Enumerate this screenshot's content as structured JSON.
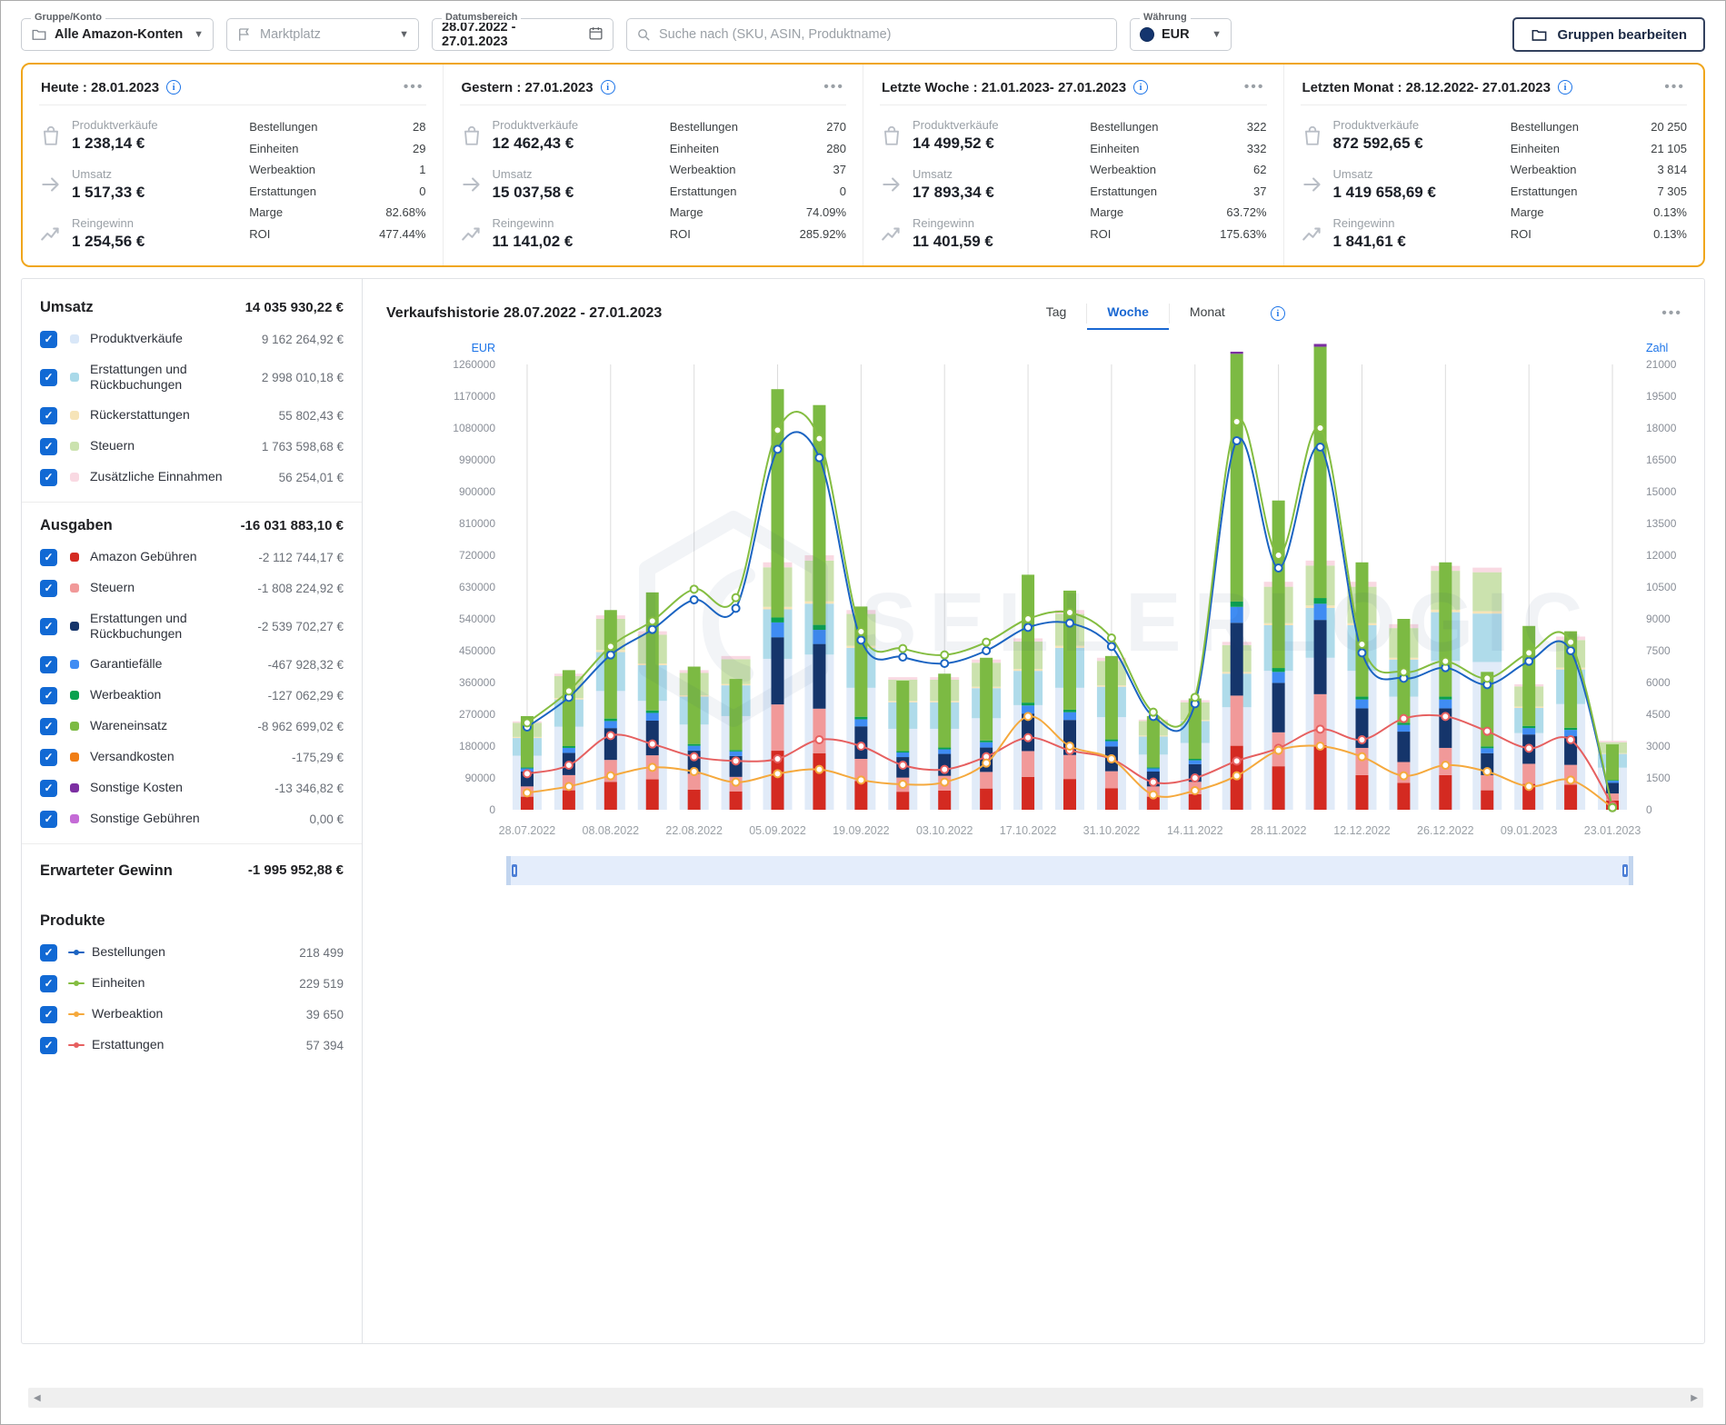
{
  "topbar": {
    "group_label": "Gruppe/Konto",
    "group_value": "Alle Amazon-Konten",
    "marketplace_placeholder": "Marktplatz",
    "daterange_label": "Datumsbereich",
    "daterange_value": "28.07.2022 - 27.01.2023",
    "search_placeholder": "Suche nach (SKU, ASIN, Produktname)",
    "currency_label": "Währung",
    "currency_value": "EUR",
    "edit_groups_label": "Gruppen bearbeiten"
  },
  "cards": [
    {
      "title": "Heute : 28.01.2023",
      "stats": [
        {
          "label": "Produktverkäufe",
          "value": "1 238,14 €",
          "icon": "bag"
        },
        {
          "label": "Umsatz",
          "value": "1 517,33 €",
          "icon": "arrow"
        },
        {
          "label": "Reingewinn",
          "value": "1 254,56 €",
          "icon": "trend"
        }
      ],
      "metrics": [
        [
          "Bestellungen",
          "28"
        ],
        [
          "Einheiten",
          "29"
        ],
        [
          "Werbeaktion",
          "1"
        ],
        [
          "Erstattungen",
          "0"
        ],
        [
          "Marge",
          "82.68%"
        ],
        [
          "ROI",
          "477.44%"
        ]
      ]
    },
    {
      "title": "Gestern : 27.01.2023",
      "stats": [
        {
          "label": "Produktverkäufe",
          "value": "12 462,43 €",
          "icon": "bag"
        },
        {
          "label": "Umsatz",
          "value": "15 037,58 €",
          "icon": "arrow"
        },
        {
          "label": "Reingewinn",
          "value": "11 141,02 €",
          "icon": "trend"
        }
      ],
      "metrics": [
        [
          "Bestellungen",
          "270"
        ],
        [
          "Einheiten",
          "280"
        ],
        [
          "Werbeaktion",
          "37"
        ],
        [
          "Erstattungen",
          "0"
        ],
        [
          "Marge",
          "74.09%"
        ],
        [
          "ROI",
          "285.92%"
        ]
      ]
    },
    {
      "title": "Letzte Woche : 21.01.2023- 27.01.2023",
      "stats": [
        {
          "label": "Produktverkäufe",
          "value": "14 499,52 €",
          "icon": "bag"
        },
        {
          "label": "Umsatz",
          "value": "17 893,34 €",
          "icon": "arrow"
        },
        {
          "label": "Reingewinn",
          "value": "11 401,59 €",
          "icon": "trend"
        }
      ],
      "metrics": [
        [
          "Bestellungen",
          "322"
        ],
        [
          "Einheiten",
          "332"
        ],
        [
          "Werbeaktion",
          "62"
        ],
        [
          "Erstattungen",
          "37"
        ],
        [
          "Marge",
          "63.72%"
        ],
        [
          "ROI",
          "175.63%"
        ]
      ]
    },
    {
      "title": "Letzten Monat : 28.12.2022- 27.01.2023",
      "stats": [
        {
          "label": "Produktverkäufe",
          "value": "872 592,65 €",
          "icon": "bag"
        },
        {
          "label": "Umsatz",
          "value": "1 419 658,69 €",
          "icon": "arrow"
        },
        {
          "label": "Reingewinn",
          "value": "1 841,61 €",
          "icon": "trend"
        }
      ],
      "metrics": [
        [
          "Bestellungen",
          "20 250"
        ],
        [
          "Einheiten",
          "21 105"
        ],
        [
          "Werbeaktion",
          "3 814"
        ],
        [
          "Erstattungen",
          "7 305"
        ],
        [
          "Marge",
          "0.13%"
        ],
        [
          "ROI",
          "0.13%"
        ]
      ]
    }
  ],
  "sidebar": {
    "umsatz": {
      "title": "Umsatz",
      "total": "14 035 930,22 €",
      "items": [
        {
          "label": "Produktverkäufe",
          "value": "9 162 264,92 €",
          "color": "#D9E7F8"
        },
        {
          "label": "Erstattungen und Rückbuchungen",
          "value": "2 998 010,18 €",
          "color": "#A9D9E9"
        },
        {
          "label": "Rückerstattungen",
          "value": "55 802,43 €",
          "color": "#F6E4B8"
        },
        {
          "label": "Steuern",
          "value": "1 763 598,68 €",
          "color": "#CBE2AE"
        },
        {
          "label": "Zusätzliche Einnahmen",
          "value": "56 254,01 €",
          "color": "#F9D9E2"
        }
      ]
    },
    "ausgaben": {
      "title": "Ausgaben",
      "total": "-16 031 883,10 €",
      "items": [
        {
          "label": "Amazon Gebühren",
          "value": "-2 112 744,17 €",
          "color": "#D42A21"
        },
        {
          "label": "Steuern",
          "value": "-1 808 224,92 €",
          "color": "#F19999"
        },
        {
          "label": "Erstattungen und Rückbuchungen",
          "value": "-2 539 702,27 €",
          "color": "#15356B"
        },
        {
          "label": "Garantiefälle",
          "value": "-467 928,32 €",
          "color": "#3F8CF3"
        },
        {
          "label": "Werbeaktion",
          "value": "-127 062,29 €",
          "color": "#0AA14F"
        },
        {
          "label": "Wareneinsatz",
          "value": "-8 962 699,02 €",
          "color": "#7CBA43"
        },
        {
          "label": "Versandkosten",
          "value": "-175,29 €",
          "color": "#F07D14"
        },
        {
          "label": "Sonstige Kosten",
          "value": "-13 346,82 €",
          "color": "#7C2FA2"
        },
        {
          "label": "Sonstige Gebühren",
          "value": "0,00 €",
          "color": "#C46BD6"
        }
      ]
    },
    "gewinn": {
      "title": "Erwarteter Gewinn",
      "total": "-1 995 952,88 €"
    },
    "produkte": {
      "title": "Produkte",
      "items": [
        {
          "label": "Bestellungen",
          "value": "218 499",
          "color": "#1B64C2"
        },
        {
          "label": "Einheiten",
          "value": "229 519",
          "color": "#84BD41"
        },
        {
          "label": "Werbeaktion",
          "value": "39 650",
          "color": "#F5A93D"
        },
        {
          "label": "Erstattungen",
          "value": "57 394",
          "color": "#E66060"
        }
      ]
    }
  },
  "chart": {
    "title": "Verkaufshistorie 28.07.2022 - 27.01.2023",
    "tabs": [
      "Tag",
      "Woche",
      "Monat"
    ],
    "active_tab": "Woche",
    "watermark": "SELLERLOGIC"
  },
  "chart_data": {
    "type": "bar",
    "subtype": "stacked-bars-with-lines",
    "title": "Verkaufshistorie 28.07.2022 - 27.01.2023",
    "axis_left": {
      "label": "EUR",
      "min": 0,
      "max": 1260000,
      "step": 90000
    },
    "axis_right": {
      "label": "Zahl",
      "min": 0,
      "max": 21000,
      "step": 1500
    },
    "x_tick_labels": [
      "28.07.2022",
      "08.08.2022",
      "22.08.2022",
      "05.09.2022",
      "19.09.2022",
      "03.10.2022",
      "17.10.2022",
      "31.10.2022",
      "14.11.2022",
      "28.11.2022",
      "12.12.2022",
      "26.12.2022",
      "09.01.2023",
      "23.01.2023"
    ],
    "bar_count": 27,
    "revenue_stack": [
      {
        "name": "Produktverkäufe",
        "color": "#E1EBF8",
        "values": [
          153000,
          235000,
          336000,
          308000,
          241000,
          265000,
          427000,
          439000,
          345000,
          229000,
          229000,
          259000,
          296000,
          345000,
          262000,
          156000,
          189000,
          290000,
          393000,
          430000,
          393000,
          320000,
          421000,
          418000,
          217000,
          299000,
          119000
        ]
      },
      {
        "name": "Erstattungen und Rückbuchungen",
        "color": "#AFDBEA",
        "values": [
          50000,
          77000,
          110000,
          101000,
          79000,
          87000,
          140000,
          144000,
          113000,
          75000,
          75000,
          85000,
          97000,
          113000,
          86000,
          51000,
          62000,
          95000,
          129000,
          141000,
          129000,
          105000,
          138000,
          137000,
          71000,
          98000,
          39000
        ]
      },
      {
        "name": "Rückerstattungen",
        "color": "#F6E4B8",
        "values": [
          3000,
          4000,
          6000,
          5000,
          4000,
          4000,
          7000,
          7000,
          6000,
          4000,
          4000,
          4000,
          5000,
          6000,
          4000,
          3000,
          3000,
          5000,
          6000,
          7000,
          6000,
          5000,
          7000,
          7000,
          4000,
          5000,
          2000
        ]
      },
      {
        "name": "Steuern",
        "color": "#CBE2AE",
        "values": [
          40000,
          62000,
          88000,
          81000,
          63000,
          70000,
          112000,
          115000,
          90000,
          60000,
          60000,
          68000,
          78000,
          90000,
          69000,
          41000,
          50000,
          76000,
          103000,
          113000,
          103000,
          84000,
          110000,
          110000,
          57000,
          78000,
          31000
        ]
      },
      {
        "name": "Zusätzliche Einnahmen",
        "color": "#F9D9E2",
        "values": [
          4000,
          7000,
          10000,
          10000,
          8000,
          9000,
          14000,
          15000,
          11000,
          7000,
          7000,
          9000,
          9000,
          11000,
          9000,
          4000,
          6000,
          9000,
          14000,
          14000,
          14000,
          11000,
          14000,
          13000,
          6000,
          10000,
          4000
        ]
      }
    ],
    "expense_stack": [
      {
        "name": "Amazon Gebühren",
        "color": "#D42A21",
        "values": [
          37000,
          55000,
          79000,
          86000,
          57000,
          52000,
          167000,
          160000,
          81000,
          51000,
          54000,
          60000,
          93000,
          87000,
          61000,
          37000,
          44000,
          181000,
          123000,
          183000,
          98000,
          76000,
          98000,
          55000,
          73000,
          71000,
          26000
        ]
      },
      {
        "name": "Steuern",
        "color": "#F19999",
        "values": [
          29000,
          43000,
          62000,
          68000,
          45000,
          41000,
          131000,
          126000,
          63000,
          40000,
          42000,
          47000,
          73000,
          68000,
          48000,
          29000,
          35000,
          142000,
          96000,
          144000,
          77000,
          59000,
          77000,
          43000,
          57000,
          56000,
          20000
        ]
      },
      {
        "name": "Erstattungen und Rückbuchungen",
        "color": "#15356B",
        "values": [
          42000,
          63000,
          90000,
          98000,
          65000,
          59000,
          190000,
          183000,
          92000,
          58000,
          62000,
          69000,
          106000,
          99000,
          70000,
          42000,
          50000,
          206000,
          140000,
          210000,
          112000,
          86000,
          112000,
          62000,
          83000,
          81000,
          30000
        ]
      },
      {
        "name": "Garantiefälle",
        "color": "#3F8CF3",
        "values": [
          9000,
          14000,
          20000,
          22000,
          14000,
          13000,
          42000,
          40000,
          20000,
          13000,
          13000,
          15000,
          23000,
          22000,
          15000,
          9000,
          11000,
          45000,
          31000,
          46000,
          25000,
          19000,
          25000,
          14000,
          18000,
          18000,
          6000
        ]
      },
      {
        "name": "Werbeaktion",
        "color": "#0AA14F",
        "values": [
          3000,
          5000,
          7000,
          7000,
          5000,
          4000,
          14000,
          14000,
          7000,
          4000,
          5000,
          5000,
          8000,
          7000,
          5000,
          3000,
          4000,
          15000,
          11000,
          16000,
          8000,
          6000,
          8000,
          5000,
          6000,
          6000,
          2000
        ]
      },
      {
        "name": "Wareneinsatz",
        "color": "#7CBA43",
        "values": [
          145000,
          215000,
          307000,
          334000,
          219000,
          201000,
          646000,
          622000,
          312000,
          199000,
          209000,
          234000,
          362000,
          337000,
          236000,
          145000,
          171000,
          701000,
          474000,
          711000,
          380000,
          294000,
          380000,
          211000,
          283000,
          273000,
          101000
        ]
      },
      {
        "name": "Sonstige Kosten",
        "color": "#7C2FA2",
        "values": [
          0,
          0,
          0,
          0,
          0,
          0,
          0,
          0,
          0,
          0,
          0,
          0,
          0,
          0,
          0,
          0,
          0,
          6000,
          0,
          8000,
          0,
          0,
          0,
          0,
          0,
          0,
          0
        ]
      }
    ],
    "lines": [
      {
        "name": "Erstattungen",
        "color": "#E66060",
        "values": [
          1700,
          2100,
          3500,
          3100,
          2500,
          2300,
          2400,
          3300,
          3000,
          2100,
          1900,
          2500,
          3400,
          2800,
          2400,
          1300,
          1500,
          2300,
          2900,
          3800,
          3300,
          4300,
          4400,
          3700,
          2900,
          3300,
          200
        ]
      },
      {
        "name": "Werbeaktion",
        "color": "#F5A93D",
        "values": [
          800,
          1100,
          1600,
          2000,
          1800,
          1300,
          1700,
          1900,
          1400,
          1200,
          1300,
          2200,
          4400,
          3000,
          2400,
          700,
          900,
          1600,
          2800,
          3000,
          2500,
          1600,
          2100,
          1800,
          1100,
          1400,
          100
        ]
      },
      {
        "name": "Bestellungen",
        "color": "#1B64C2",
        "values": [
          3900,
          5300,
          7300,
          8500,
          9900,
          9500,
          17000,
          16600,
          8000,
          7200,
          6900,
          7500,
          8600,
          8800,
          7700,
          4400,
          5000,
          17400,
          11400,
          17100,
          7400,
          6200,
          6700,
          5900,
          7000,
          7500,
          100
        ]
      },
      {
        "name": "Einheiten",
        "color": "#84BD41",
        "values": [
          4100,
          5600,
          7700,
          8900,
          10400,
          10000,
          17900,
          17500,
          8400,
          7600,
          7300,
          7900,
          9000,
          9300,
          8100,
          4600,
          5300,
          18300,
          12000,
          18000,
          7800,
          6500,
          7000,
          6200,
          7400,
          7900,
          100
        ]
      }
    ]
  }
}
